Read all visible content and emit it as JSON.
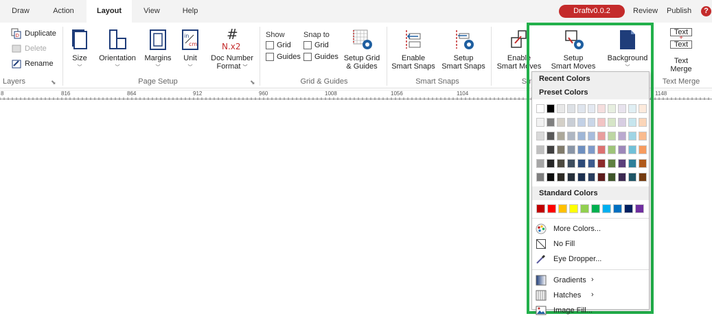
{
  "tabs": [
    {
      "label": "Draw"
    },
    {
      "label": "Action"
    },
    {
      "label": "Layout"
    },
    {
      "label": "View"
    },
    {
      "label": "Help"
    }
  ],
  "version_badge": "Draftv0.0.2",
  "review_label": "Review",
  "publish_label": "Publish",
  "help_label": "?",
  "ribbon": {
    "layers": {
      "duplicate": "Duplicate",
      "delete": "Delete",
      "rename": "Rename",
      "group_label": "Layers"
    },
    "page_setup": {
      "size": "Size",
      "orientation": "Orientation",
      "margins": "Margins",
      "unit": "Unit",
      "doc_number_line1": "Doc Number",
      "doc_number_line2": "Format",
      "group_label": "Page Setup"
    },
    "grid_guides": {
      "show": "Show",
      "snap_to": "Snap to",
      "grid": "Grid",
      "guides": "Guides",
      "setup_line1": "Setup Grid",
      "setup_line2": "& Guides",
      "group_label": "Grid & Guides"
    },
    "smart_snaps": {
      "enable_line1": "Enable",
      "enable_line2": "Smart Snaps",
      "setup_line1": "Setup",
      "setup_line2": "Smart Snaps",
      "group_label": "Smart Snaps"
    },
    "smart_moves": {
      "enable_line1": "Enable",
      "enable_line2": "Smart Moves",
      "setup_line1": "Setup",
      "setup_line2": "Smart Moves",
      "group_label": "Sm"
    },
    "background": {
      "label": "Background"
    },
    "text_merge": {
      "icon_top": "Text",
      "icon_bottom": "Text",
      "line1": "Text",
      "line2": "Merge",
      "group_label": "Text Merge"
    }
  },
  "ruler": {
    "labels": [
      "8",
      "816",
      "864",
      "912",
      "960",
      "1008",
      "1056",
      "1104",
      "1148"
    ]
  },
  "background_menu": {
    "recent_header": "Recent Colors",
    "preset_header": "Preset Colors",
    "preset_rows": [
      [
        "#ffffff",
        "#000000",
        "#e8e8e8",
        "#dde1e6",
        "#dfe5ee",
        "#e4e9f2",
        "#f5dede",
        "#e7efe0",
        "#e8e3ee",
        "#e0eff4",
        "#fdeadc"
      ],
      [
        "#f2f2f2",
        "#7f7f7f",
        "#d4d0c8",
        "#c9ced6",
        "#c3d1e6",
        "#cad6e8",
        "#f2c4c4",
        "#d6e5c7",
        "#d7cde2",
        "#c6e5ee",
        "#fbd5b8"
      ],
      [
        "#d9d9d9",
        "#595959",
        "#aca89a",
        "#aeb6c2",
        "#9fb6d6",
        "#a7bcdc",
        "#e89d9d",
        "#bdd6a3",
        "#baa9cf",
        "#9fd4e4",
        "#f9bb8e"
      ],
      [
        "#bfbfbf",
        "#404040",
        "#807b6c",
        "#8995a6",
        "#6e8fbf",
        "#7e9ac9",
        "#dc7171",
        "#9ec479",
        "#9d88ba",
        "#70c0d8",
        "#f79b5f"
      ],
      [
        "#a6a6a6",
        "#262626",
        "#4d4a40",
        "#3d4d5e",
        "#2d4a78",
        "#3d5b8e",
        "#8c2b2b",
        "#5e8040",
        "#5a3f7a",
        "#2e7f99",
        "#b05a1a"
      ],
      [
        "#7f7f7f",
        "#0d0d0d",
        "#2e2c26",
        "#262f3a",
        "#1d3050",
        "#293d5f",
        "#5c1c1c",
        "#3f552b",
        "#3c2a52",
        "#1f5566",
        "#753c11"
      ]
    ],
    "standard_header": "Standard Colors",
    "standard_colors": [
      "#c00000",
      "#ff0000",
      "#ffc000",
      "#ffff00",
      "#92d050",
      "#00b050",
      "#00b0f0",
      "#0070c0",
      "#002060",
      "#7030a0"
    ],
    "items": {
      "more_colors": "More Colors...",
      "no_fill": "No Fill",
      "eye_dropper": "Eye Dropper...",
      "gradients": "Gradients",
      "hatches": "Hatches",
      "image_fill": "Image Fill..."
    }
  },
  "colors": {
    "accent_red": "#c42b2b",
    "highlight_green": "#22b04b",
    "icon_blue": "#1f3d7a"
  }
}
